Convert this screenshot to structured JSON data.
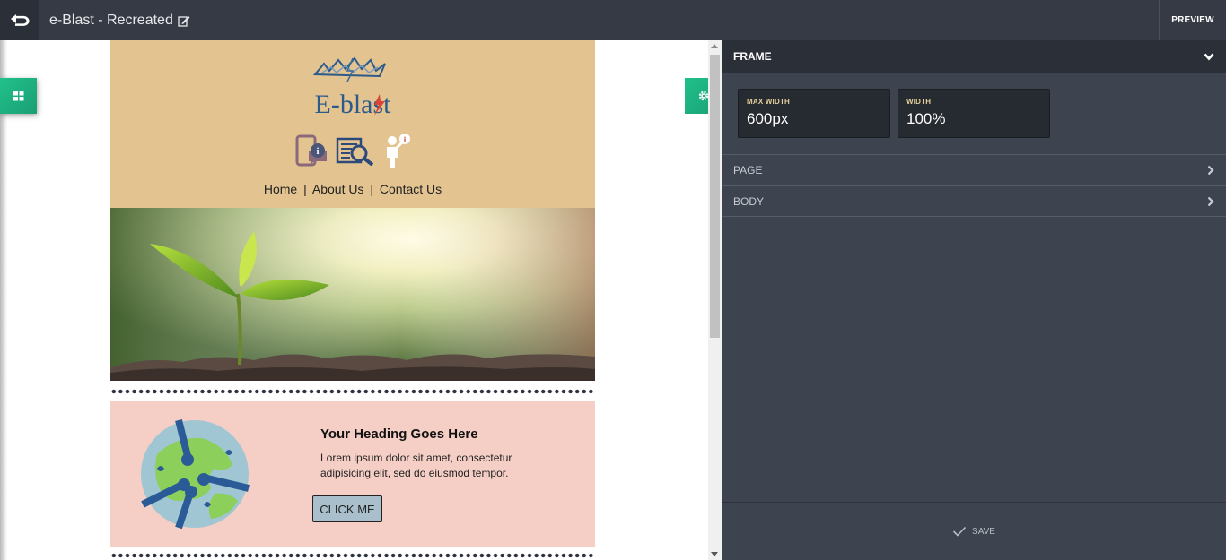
{
  "topbar": {
    "back_icon": "undo-arrow-icon",
    "title": "e-Blast - Recreated",
    "edit_icon": "edit-icon",
    "preview_label": "PREVIEW"
  },
  "canvas": {
    "blocks_icon": "grid-icon",
    "settings_icon": "gear-icon",
    "email": {
      "logo_text": "E-blast",
      "header_icons": [
        "phone-info-icon",
        "document-search-icon",
        "person-info-icon"
      ],
      "nav": {
        "home": "Home",
        "about": "About Us",
        "contact": "Contact Us",
        "separator": "|"
      },
      "hero_alt": "sprout-photo",
      "promo": {
        "image": "globe-hands-icon",
        "heading": "Your Heading Goes Here",
        "text": "Lorem ipsum dolor sit amet, consectetur adipisicing elit, sed do eiusmod tempor.",
        "button_label": "CLICK ME"
      }
    }
  },
  "panel": {
    "frame_label": "FRAME",
    "max_width_label": "MAX WIDTH",
    "max_width_value": "600px",
    "width_label": "WIDTH",
    "width_value": "100%",
    "page_label": "PAGE",
    "body_label": "BODY",
    "save_label": "SAVE"
  },
  "colors": {
    "topbar": "#353a44",
    "panel": "#3d4450",
    "accent": "#21c18b",
    "header_bg": "#e3c491",
    "promo_bg": "#f5cfc6",
    "button_bg": "#a9c0cc"
  }
}
